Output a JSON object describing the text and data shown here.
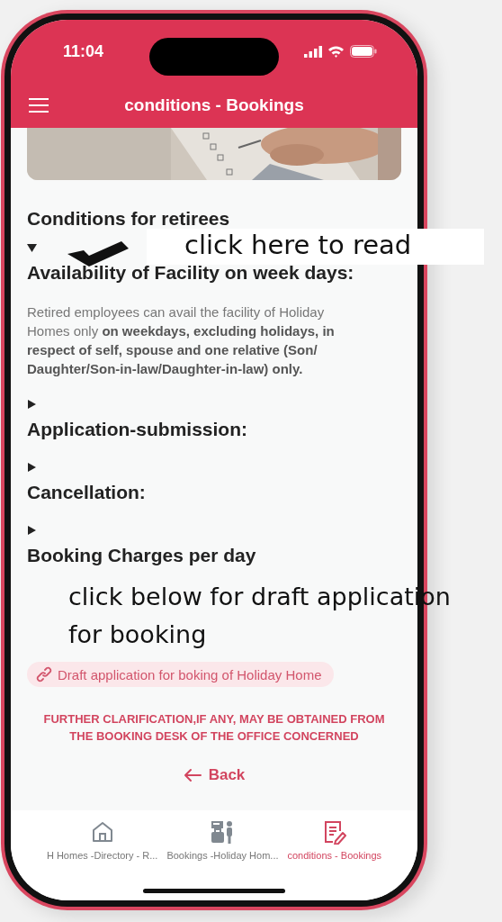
{
  "status_bar": {
    "time": "11:04"
  },
  "app_bar": {
    "title": "conditions - Bookings"
  },
  "page_title": "Conditions for retirees",
  "sections": [
    {
      "title": "Availability of Facility on week days:",
      "expanded": true,
      "body": "Retired employees can avail the facility of Holiday Homes only **on weekdays, excluding holidays, in respect of self, spouse and one relative (Son/ Daughter/Son-in-law/Daughter-in-law) only.**"
    },
    {
      "title": "Application-submission:",
      "expanded": false
    },
    {
      "title": "Cancellation:",
      "expanded": false
    },
    {
      "title": "Booking Charges per day",
      "expanded": false
    }
  ],
  "draft_link": "Draft application for boking of Holiday Home",
  "notice": "FURTHER CLARIFICATION,IF ANY, MAY BE OBTAINED FROM THE BOOKING DESK OF THE OFFICE CONCERNED",
  "back_button": "Back",
  "tabs": [
    {
      "label": "H Homes -Directory - R...",
      "kind": "home",
      "selected": false
    },
    {
      "label": "Bookings -Holiday Hom...",
      "kind": "desk",
      "selected": false
    },
    {
      "label": "conditions - Bookings",
      "kind": "note",
      "selected": true
    }
  ],
  "annotations": [
    {
      "text": "click here to read"
    },
    {
      "text": "click below for draft application for booking"
    }
  ]
}
